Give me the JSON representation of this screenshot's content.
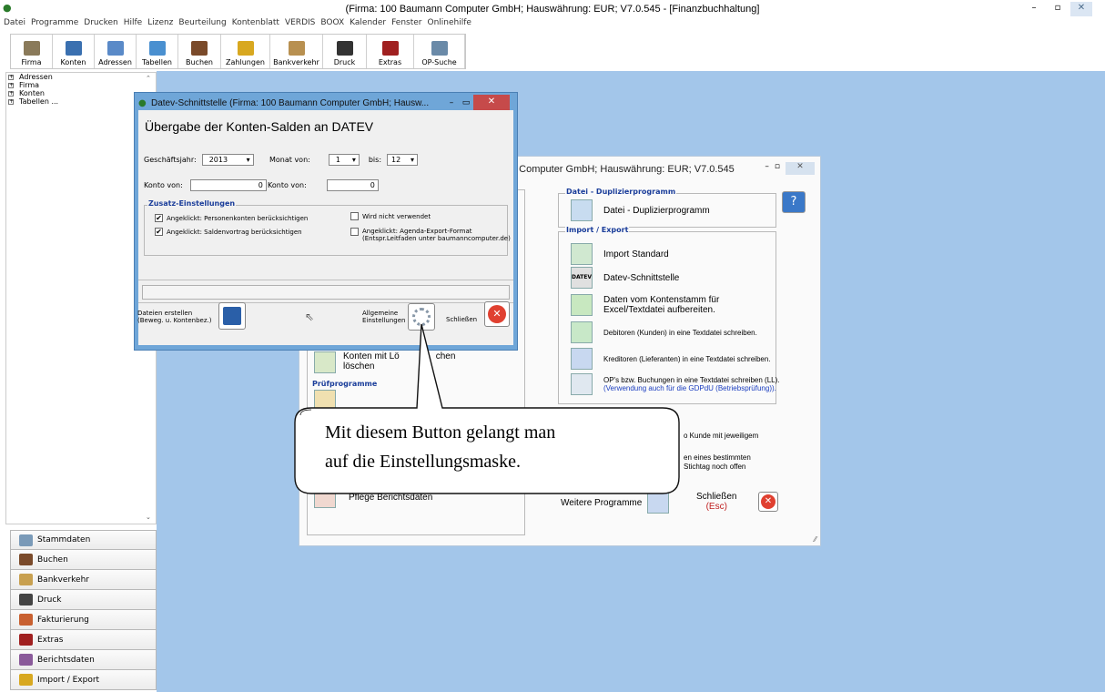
{
  "app": {
    "title": "(Firma: 100 Baumann Computer GmbH;   Hauswährung: EUR; V7.0.545 - [Finanzbuchhaltung]",
    "min": "–",
    "max": "▫",
    "close": "✕"
  },
  "menu": [
    "Datei",
    "Programme",
    "Drucken",
    "Hilfe",
    "Lizenz",
    "Beurteilung",
    "Kontenblatt",
    "VERDIS",
    "BOOX",
    "Kalender",
    "Fenster",
    "Onlinehilfe"
  ],
  "toolbar": [
    {
      "label": "Firma",
      "icon": "company-icon",
      "color": "#8a7a5a"
    },
    {
      "label": "Konten",
      "icon": "accounts-icon",
      "color": "#3a70b0"
    },
    {
      "label": "Adressen",
      "icon": "address-icon",
      "color": "#5a8ac8"
    },
    {
      "label": "Tabellen",
      "icon": "table-icon",
      "color": "#4a90d0"
    },
    {
      "label": "Buchen",
      "icon": "book-icon",
      "color": "#7a4a2a"
    },
    {
      "label": "Zahlungen",
      "icon": "coins-icon",
      "color": "#d8a820"
    },
    {
      "label": "Bankverkehr",
      "icon": "moneybag-icon",
      "color": "#b89050"
    },
    {
      "label": "Druck",
      "icon": "printer-icon",
      "color": "#333333"
    },
    {
      "label": "Extras",
      "icon": "tools-icon",
      "color": "#a02020"
    },
    {
      "label": "OP-Suche",
      "icon": "search-icon",
      "color": "#6a8aa8"
    }
  ],
  "tree": [
    "Adressen",
    "Firma",
    "Konten",
    "Tabellen ..."
  ],
  "nav": [
    {
      "label": "Stammdaten",
      "icon": "master-data-icon",
      "color": "#7a9ab8"
    },
    {
      "label": "Buchen",
      "icon": "book-icon",
      "color": "#7a4a2a"
    },
    {
      "label": "Bankverkehr",
      "icon": "moneybag-icon",
      "color": "#c8a050"
    },
    {
      "label": "Druck",
      "icon": "printer-icon",
      "color": "#444444"
    },
    {
      "label": "Fakturierung",
      "icon": "invoice-icon",
      "color": "#c86030"
    },
    {
      "label": "Extras",
      "icon": "tools-icon",
      "color": "#a02020"
    },
    {
      "label": "Berichtsdaten",
      "icon": "report-icon",
      "color": "#8a5a9a"
    },
    {
      "label": "Import / Export",
      "icon": "import-export-icon",
      "color": "#d8a820"
    }
  ],
  "back": {
    "title": "n Computer GmbH;  Hauswährung: EUR; V7.0.545",
    "grp_dup": "Datei - Duplizierprogramm",
    "dup": "Datei - Duplizierprogramm",
    "grp_ie": "Import / Export",
    "ie": [
      "Import Standard",
      "Datev-Schnittstelle"
    ],
    "kontenstamm1": "Daten vom Kontenstamm für",
    "kontenstamm2": "Excel/Textdatei aufbereiten.",
    "debitoren": "Debitoren (Kunden) in eine Textdatei schreiben.",
    "kreditoren": "Kreditoren (Lieferanten) in eine Textdatei schreiben.",
    "ops1": "OP's bzw. Buchungen in eine Textdatei schreiben (LL).",
    "ops2": "(Verwendung auch für die GDPdU (Betriebsprüfung)).",
    "partial1": "o Kunde mit jeweiligem",
    "partial2": "en eines bestimmten",
    "partial3": "Stichtag noch offen",
    "konten1": "Konten mit Lö",
    "konten2": "chen",
    "konten3": "löschen",
    "pruef": "Prüfprogramme",
    "pflege": "Pflege Berichtsdaten",
    "weitere": "Weitere Programme",
    "schliessen": "Schließen",
    "esc": "(Esc)",
    "help": "?"
  },
  "dialog": {
    "title": "Datev-Schnittstelle  (Firma: 100 Baumann Computer GmbH;  Hausw...",
    "heading": "Übergabe der Konten-Salden an DATEV",
    "gj_label": "Geschäftsjahr:",
    "gj_value": "2013",
    "monat_label": "Monat von:",
    "monat_von": "1",
    "bis_label": "bis:",
    "monat_bis": "12",
    "konto_von_label": "Konto von:",
    "konto_von": "0",
    "konto_bis_label": "Konto von:",
    "konto_bis": "0",
    "zusatz": "Zusatz-Einstellungen",
    "cb1": "Angeklickt: Personenkonten berücksichtigen",
    "cb2": "Angeklickt: Saldenvortrag berücksichtigen",
    "cb3": "Wird nicht verwendet",
    "cb4a": "Angeklickt: Agenda-Export-Format",
    "cb4b": "(Entspr.Leitfaden unter baumanncomputer.de)",
    "dateien1": "Dateien erstellen",
    "dateien2": "(Beweg. u. Kontenbez.)",
    "allg1": "Allgemeine",
    "allg2": "Einstellungen",
    "schliessen": "Schließen",
    "checked": "✔"
  },
  "callout": {
    "line1": "Mit diesem Button gelangt man",
    "line2": "auf die Einstellungsmaske."
  }
}
